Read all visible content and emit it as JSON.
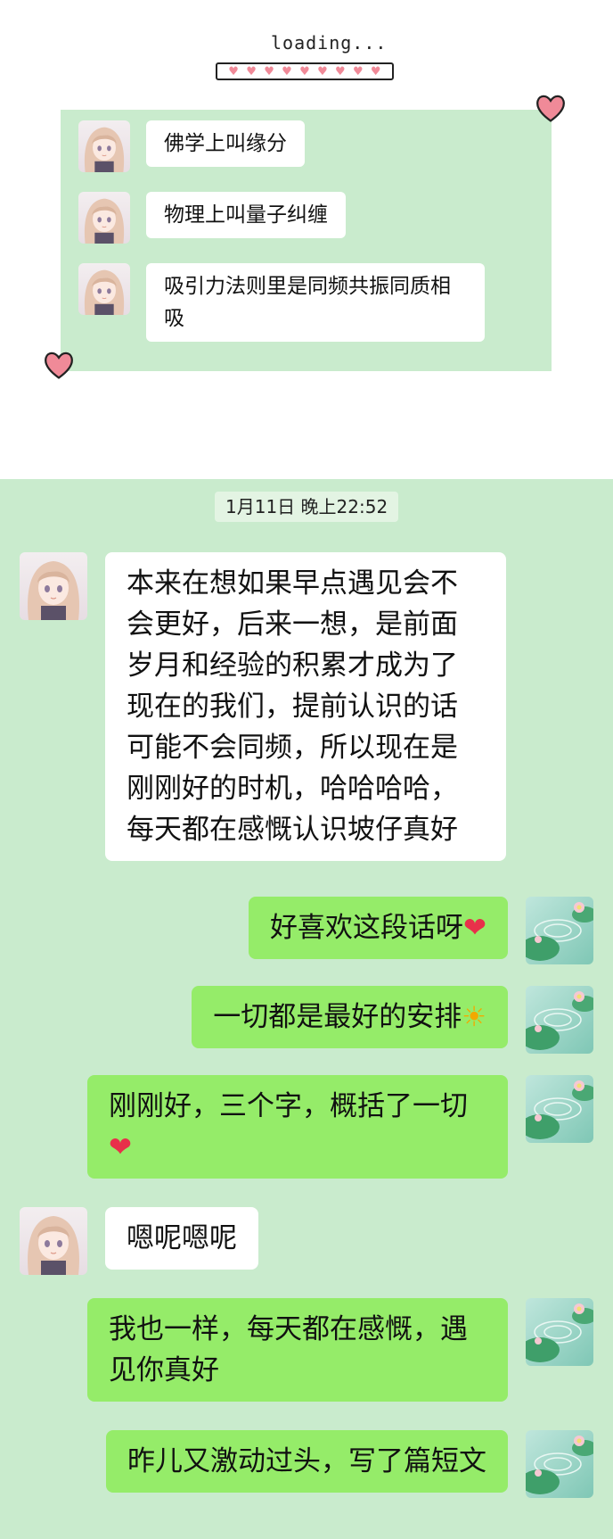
{
  "loading": {
    "text": "loading...",
    "hearts": [
      "♥",
      "♥",
      "♥",
      "♥",
      "♥",
      "♥",
      "♥",
      "♥",
      "♥"
    ]
  },
  "top_card": {
    "messages": [
      {
        "text": "佛学上叫缘分"
      },
      {
        "text": "物理上叫量子纠缠"
      },
      {
        "text": "吸引力法则里是同频共振同质相吸"
      }
    ]
  },
  "chat": {
    "timestamp": "1月11日 晚上22:52",
    "messages": [
      {
        "side": "left",
        "text": "本来在想如果早点遇见会不会更好，后来一想，是前面岁月和经验的积累才成为了现在的我们，提前认识的话可能不会同频，所以现在是刚刚好的时机，哈哈哈哈，每天都在感慨认识坡仔真好"
      },
      {
        "side": "right",
        "text": "好喜欢这段话呀",
        "emoji": "❤"
      },
      {
        "side": "right",
        "text": "一切都是最好的安排",
        "emoji": "☀"
      },
      {
        "side": "right",
        "text": "刚刚好，三个字，概括了一切",
        "emoji": "❤"
      },
      {
        "side": "left",
        "text": "嗯呢嗯呢"
      },
      {
        "side": "right",
        "text": "我也一样，每天都在感慨，遇见你真好"
      },
      {
        "side": "right",
        "text": "昨儿又激动过头，写了篇短文"
      }
    ]
  },
  "colors": {
    "chat_background": "#c9ebcd",
    "incoming_bubble": "#ffffff",
    "outgoing_bubble": "#95ec69",
    "heart": "#f08a98"
  },
  "icons": {
    "her_avatar": "anime-girl-avatar-icon",
    "my_avatar": "lotus-pond-avatar-icon",
    "decor": "heart-icon"
  }
}
